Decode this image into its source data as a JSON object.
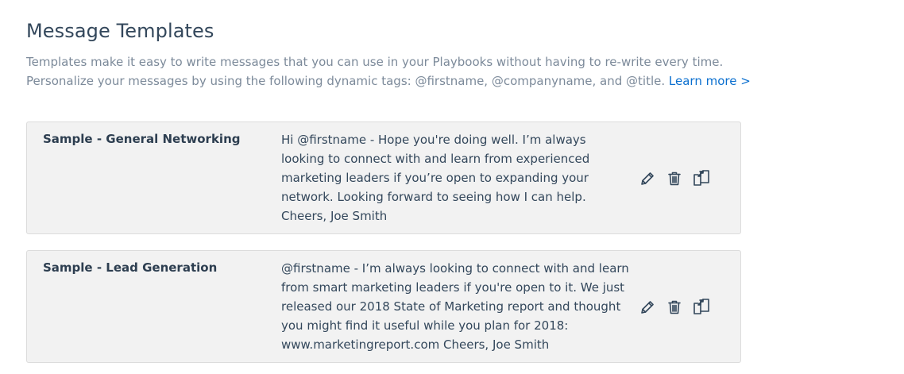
{
  "header": {
    "title": "Message Templates",
    "intro_line1": "Templates make it easy to write messages that you can use in your Playbooks without having to re-write every time.",
    "intro_line2": "Personalize your messages by using the following dynamic tags: @firstname, @companyname, and @title.",
    "learn_more": "Learn more >"
  },
  "templates": [
    {
      "name": "Sample - General Networking",
      "body": "Hi @firstname - Hope you're doing well. I’m always looking to connect with and learn from experienced marketing leaders if you’re open to expanding your network. Looking forward to seeing how I can help. Cheers, Joe Smith"
    },
    {
      "name": "Sample - Lead Generation",
      "body": "@firstname - I’m always looking to connect with and learn from smart marketing leaders if you're open to it. We just released our 2018 State of Marketing report and thought you might find it useful while you plan for 2018: www.marketingreport.com Cheers, Joe Smith"
    }
  ],
  "icons": {
    "edit": "pencil-icon",
    "delete": "trash-icon",
    "copy": "copy-icon"
  },
  "colors": {
    "title": "#33475b",
    "muted_text": "#7c8a9a",
    "link": "#0a6fcf",
    "card_bg": "#f2f2f2",
    "card_border": "#dcdcdc",
    "icon": "#33475b"
  }
}
